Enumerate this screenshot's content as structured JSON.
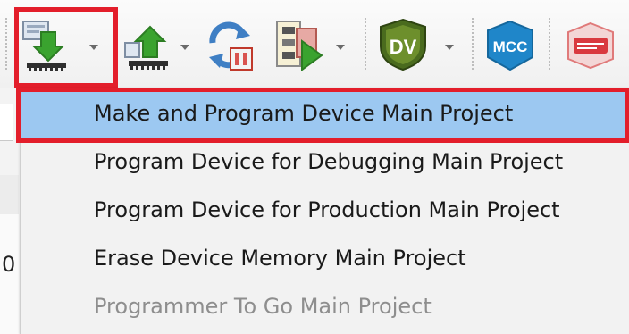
{
  "toolbar": {
    "buttons": [
      {
        "id": "make-and-program",
        "icon": "download-to-device-icon",
        "has_dropdown": true,
        "highlighted": true
      },
      {
        "id": "read-device",
        "icon": "upload-from-device-icon",
        "has_dropdown": true
      },
      {
        "id": "hold-in-reset",
        "icon": "reset-device-icon",
        "has_dropdown": false
      },
      {
        "id": "debug-run",
        "icon": "debug-run-icon",
        "has_dropdown": true
      },
      {
        "id": "dv",
        "icon": "dv-shield-icon",
        "label": "DV",
        "has_dropdown": true
      },
      {
        "id": "mcc",
        "icon": "mcc-icon",
        "label": "MCC",
        "has_dropdown": false
      },
      {
        "id": "discover",
        "icon": "microchip-discover-icon",
        "has_dropdown": false
      }
    ]
  },
  "left_panel": {
    "partial_char": "0"
  },
  "menu": {
    "items": [
      {
        "label": "Make and Program Device Main Project",
        "selected": true,
        "enabled": true
      },
      {
        "label": "Program Device for Debugging Main Project",
        "selected": false,
        "enabled": true
      },
      {
        "label": "Program Device for Production Main Project",
        "selected": false,
        "enabled": true
      },
      {
        "label": "Erase Device Memory Main Project",
        "selected": false,
        "enabled": true
      },
      {
        "label": "Programmer To Go Main Project",
        "selected": false,
        "enabled": false
      }
    ]
  },
  "colors": {
    "highlight_border": "#e31e2b",
    "selected_row": "#9cc8f1",
    "disabled_text": "#8e8e8e",
    "arrow_green": "#3aa32f",
    "dv_green": "#4a6b1e",
    "mcc_blue": "#1f86c9"
  }
}
